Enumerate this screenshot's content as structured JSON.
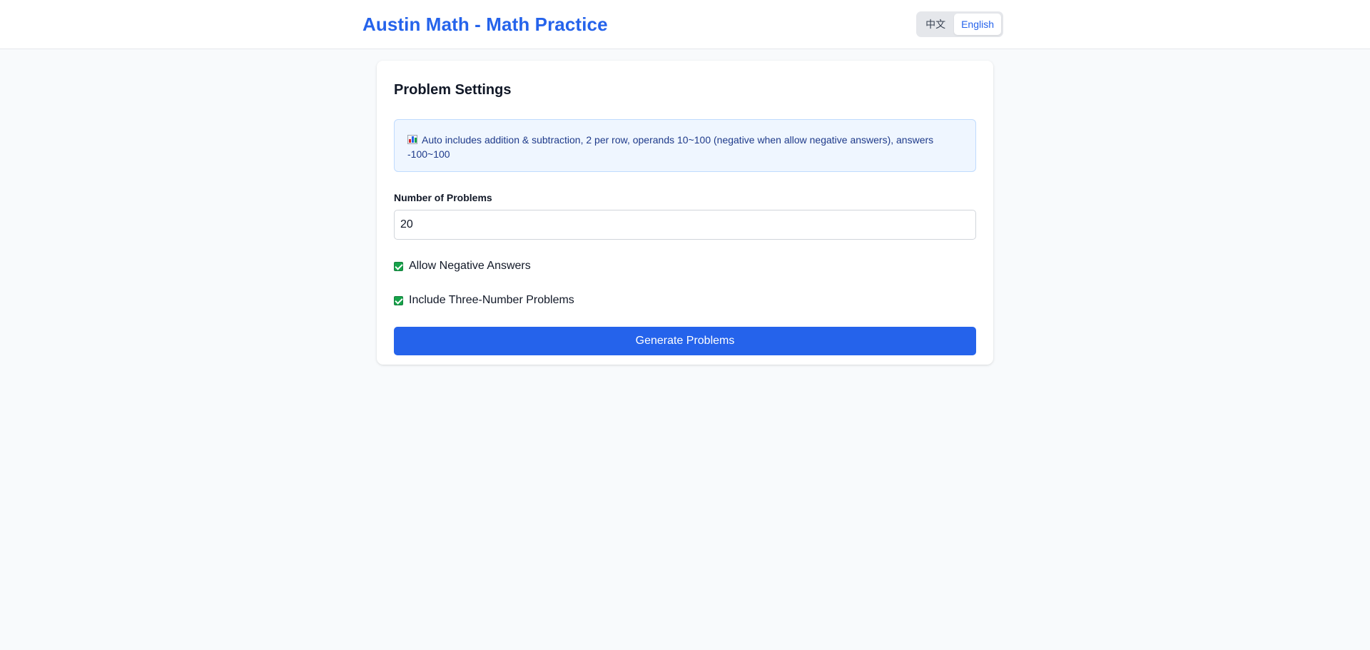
{
  "header": {
    "title": "Austin Math - Math Practice",
    "languages": [
      {
        "label": "中文",
        "active": false
      },
      {
        "label": "English",
        "active": true
      }
    ]
  },
  "settings": {
    "title": "Problem Settings",
    "info_icon": "bar-chart-icon",
    "info_text": "Auto includes addition & subtraction, 2 per row, operands 10~100 (negative when allow negative answers), answers -100~100",
    "count_label": "Number of Problems",
    "count_value": "20",
    "options": [
      {
        "label": "Allow Negative Answers",
        "checked": true
      },
      {
        "label": "Include Three-Number Problems",
        "checked": true
      }
    ],
    "generate_label": "Generate Problems"
  },
  "colors": {
    "accent": "#2563eb",
    "checkbox": "#16a34a",
    "info_bg": "#eff6ff",
    "page_bg": "#f8fafc"
  }
}
